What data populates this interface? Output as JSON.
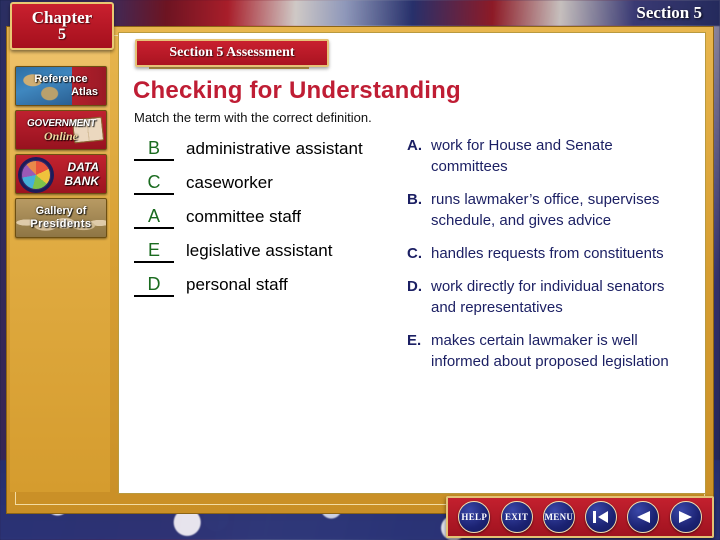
{
  "header": {
    "chapter_word": "Chapter",
    "chapter_number": "5",
    "section_label": "Section 5"
  },
  "sidebar": {
    "items": [
      {
        "id": "reference-atlas",
        "line1": "Reference",
        "line2": "Atlas",
        "icon": "globe-icon"
      },
      {
        "id": "government-online",
        "line1": "GOVERNMENT",
        "line2": "Online",
        "icon": "book-icon"
      },
      {
        "id": "data-bank",
        "line1": "DATA",
        "line2": "BANK",
        "icon": "pie-chart-icon"
      },
      {
        "id": "gallery-of-presidents",
        "line1": "Gallery of",
        "line2": "Presidents",
        "icon": "portraits-icon"
      }
    ]
  },
  "main": {
    "banner": "Section 5 Assessment",
    "title": "Checking for Understanding",
    "instruction": "Match the term with the correct definition.",
    "terms": [
      {
        "answer": "B",
        "text": "administrative assistant"
      },
      {
        "answer": "C",
        "text": "caseworker"
      },
      {
        "answer": "A",
        "text": "committee staff"
      },
      {
        "answer": "E",
        "text": "legislative assistant"
      },
      {
        "answer": "D",
        "text": "personal staff"
      }
    ],
    "definitions": [
      {
        "letter": "A.",
        "text": "work for House and Senate committees"
      },
      {
        "letter": "B.",
        "text": "runs lawmaker’s office, supervises schedule, and gives advice"
      },
      {
        "letter": "C.",
        "text": "handles requests from constituents"
      },
      {
        "letter": "D.",
        "text": "work directly for individual senators and representatives"
      },
      {
        "letter": "E.",
        "text": "makes certain lawmaker is well informed about proposed legislation"
      }
    ]
  },
  "nav": {
    "buttons": [
      {
        "id": "help",
        "label": "HELP",
        "type": "text"
      },
      {
        "id": "exit",
        "label": "EXIT",
        "type": "text"
      },
      {
        "id": "menu",
        "label": "MENU",
        "type": "text"
      },
      {
        "id": "first",
        "label": "",
        "type": "first-slide-arrow"
      },
      {
        "id": "previous",
        "label": "",
        "type": "back-arrow"
      },
      {
        "id": "next",
        "label": "",
        "type": "forward-arrow"
      }
    ]
  },
  "colors": {
    "crimson": "#bf1d34",
    "navy": "#1b1f63",
    "gold": "#e2ae45",
    "green": "#1a6b1f"
  }
}
